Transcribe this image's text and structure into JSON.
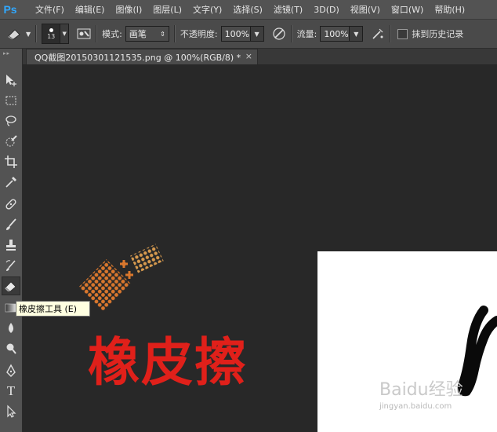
{
  "app": {
    "logo": "Ps",
    "menu": [
      "文件(F)",
      "编辑(E)",
      "图像(I)",
      "图层(L)",
      "文字(Y)",
      "选择(S)",
      "滤镜(T)",
      "3D(D)",
      "视图(V)",
      "窗口(W)",
      "帮助(H)"
    ]
  },
  "options": {
    "brush_size": "13",
    "mode_label": "模式:",
    "mode_value": "画笔",
    "opacity_label": "不透明度:",
    "opacity_value": "100%",
    "flow_label": "流量:",
    "flow_value": "100%",
    "erase_history_label": "抹到历史记录"
  },
  "document": {
    "tab_title": "QQ截图20150301121535.png @ 100%(RGB/8) *",
    "close_glyph": "×"
  },
  "tooltip": {
    "text": "橡皮擦工具 (E)"
  },
  "canvas": {
    "title_text": "橡皮擦"
  },
  "watermark": {
    "main": "Baidu经验",
    "sub": "jingyan.baidu.com"
  },
  "colors": {
    "title_red": "#e0201a",
    "ps_blue": "#31a8ff",
    "eraser_orange": "#d9772d"
  }
}
